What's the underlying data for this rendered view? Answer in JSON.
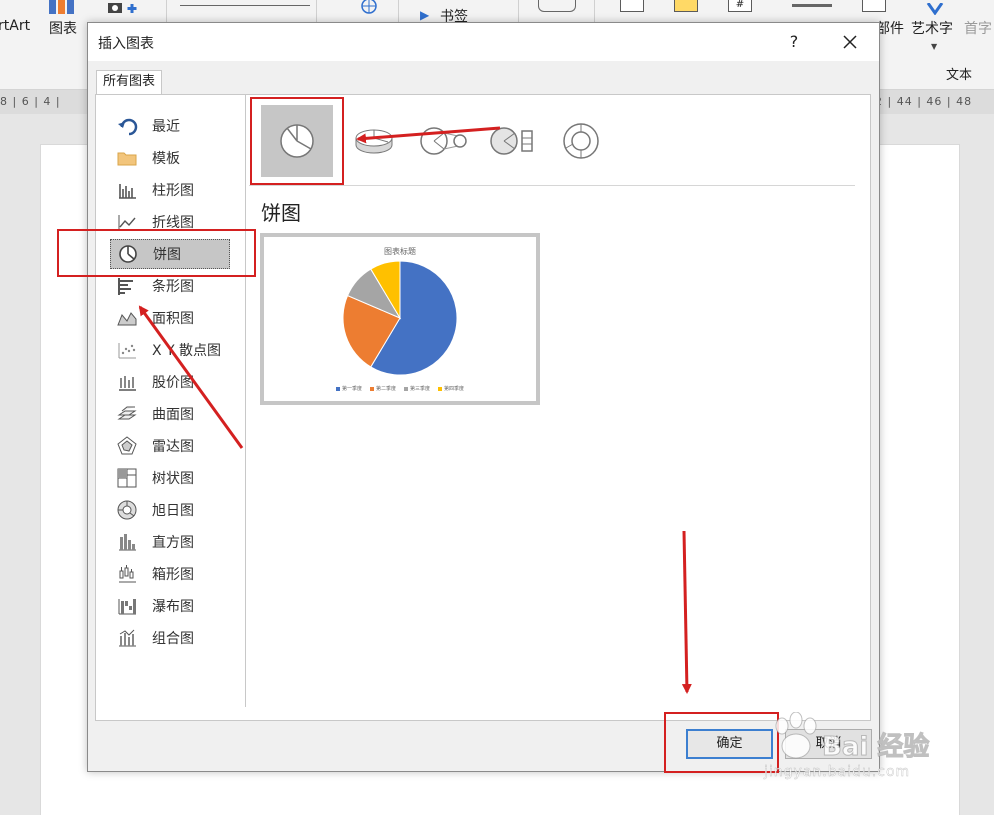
{
  "ribbon": {
    "smartart": "rtArt",
    "chart": "图表",
    "screenshot_label": "",
    "bookmark": "书签",
    "partial_label": "部件",
    "wordart": "艺术字",
    "dropcap": "首字",
    "group_text": "文本"
  },
  "ruler": {
    "left": "8 | 6 | 4 |",
    "right": "2 | 44 | 46 | 48"
  },
  "dialog": {
    "title": "插入图表",
    "help": "?",
    "tab": "所有图表",
    "chart_types": [
      {
        "label": "最近",
        "icon": "recent-icon"
      },
      {
        "label": "模板",
        "icon": "folder-icon"
      },
      {
        "label": "柱形图",
        "icon": "column-chart-icon"
      },
      {
        "label": "折线图",
        "icon": "line-chart-icon"
      },
      {
        "label": "饼图",
        "icon": "pie-chart-icon"
      },
      {
        "label": "条形图",
        "icon": "bar-chart-icon"
      },
      {
        "label": "面积图",
        "icon": "area-chart-icon"
      },
      {
        "label": "X Y 散点图",
        "icon": "scatter-chart-icon"
      },
      {
        "label": "股价图",
        "icon": "stock-chart-icon"
      },
      {
        "label": "曲面图",
        "icon": "surface-chart-icon"
      },
      {
        "label": "雷达图",
        "icon": "radar-chart-icon"
      },
      {
        "label": "树状图",
        "icon": "treemap-chart-icon"
      },
      {
        "label": "旭日图",
        "icon": "sunburst-chart-icon"
      },
      {
        "label": "直方图",
        "icon": "histogram-chart-icon"
      },
      {
        "label": "箱形图",
        "icon": "boxwhisker-chart-icon"
      },
      {
        "label": "瀑布图",
        "icon": "waterfall-chart-icon"
      },
      {
        "label": "组合图",
        "icon": "combo-chart-icon"
      }
    ],
    "selected_type": "饼图",
    "subtypes": [
      "pie-icon",
      "3d-pie-icon",
      "pie-of-pie-icon",
      "bar-of-pie-icon",
      "doughnut-icon"
    ],
    "chart_name": "饼图",
    "ok": "确定",
    "cancel": "取消"
  },
  "chart_data": {
    "type": "pie",
    "title": "图表标题",
    "categories": [
      "第一季度",
      "第二季度",
      "第三季度",
      "第四季度"
    ],
    "values": [
      8.2,
      3.2,
      1.4,
      1.2
    ],
    "colors": [
      "#4472c4",
      "#ed7d31",
      "#a5a5a5",
      "#ffc000"
    ],
    "legend": "bottom"
  },
  "watermark": {
    "brand": "Bai 经验",
    "url": "jingyan.baidu.com"
  },
  "colors": {
    "highlight": "#d42020",
    "selection": "#c6c6c6",
    "ok_border": "#3c7fd0"
  }
}
